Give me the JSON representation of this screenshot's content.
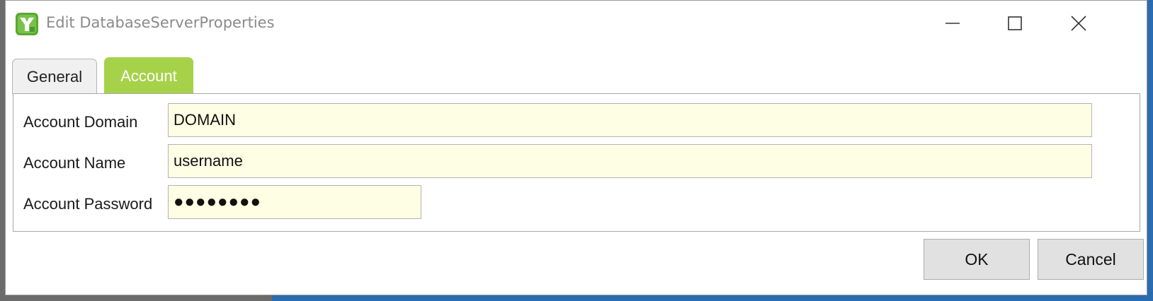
{
  "window": {
    "title": "Edit DatabaseServerProperties",
    "controls": {
      "minimize": "minimize-icon",
      "maximize": "maximize-icon",
      "close": "close-icon"
    }
  },
  "tabs": [
    {
      "label": "General",
      "active": false
    },
    {
      "label": "Account",
      "active": true
    }
  ],
  "form": {
    "account_domain": {
      "label": "Account Domain",
      "value": "DOMAIN"
    },
    "account_name": {
      "label": "Account Name",
      "value": "username"
    },
    "account_password": {
      "label": "Account Password",
      "value": "●●●●●●●●"
    }
  },
  "buttons": {
    "ok": "OK",
    "cancel": "Cancel"
  },
  "colors": {
    "active_tab": "#a6d24a",
    "field_background": "#fefee4",
    "button_background": "#e1e1e1"
  }
}
